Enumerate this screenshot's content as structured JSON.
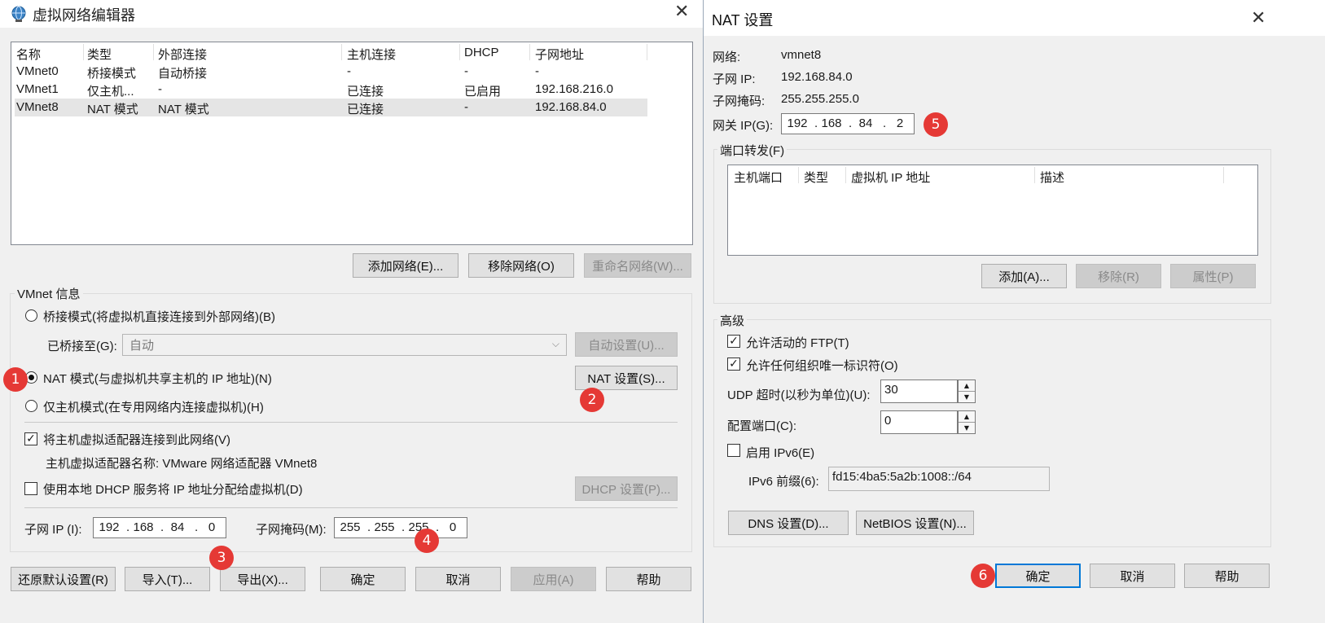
{
  "left_window": {
    "title": "虚拟网络编辑器",
    "icon": "globe-network-icon",
    "list": {
      "columns": [
        "名称",
        "类型",
        "外部连接",
        "主机连接",
        "DHCP",
        "子网地址"
      ],
      "rows": [
        [
          "VMnet0",
          "桥接模式",
          "自动桥接",
          "-",
          "-",
          "-"
        ],
        [
          "VMnet1",
          "仅主机...",
          "-",
          "已连接",
          "已启用",
          "192.168.216.0"
        ],
        [
          "VMnet8",
          "NAT 模式",
          "NAT 模式",
          "已连接",
          "-",
          "192.168.84.0"
        ]
      ]
    },
    "buttons": {
      "add_network": "添加网络(E)...",
      "remove_network": "移除网络(O)",
      "rename_network": "重命名网络(W)..."
    },
    "vmnet_info": {
      "legend": "VMnet 信息",
      "bridge_mode": "桥接模式(将虚拟机直接连接到外部网络)(B)",
      "bridged_to_label": "已桥接至(G):",
      "bridged_to_value": "自动",
      "auto_settings": "自动设置(U)...",
      "nat_mode": "NAT 模式(与虚拟机共享主机的 IP 地址)(N)",
      "nat_settings": "NAT 设置(S)...",
      "host_only_mode": "仅主机模式(在专用网络内连接虚拟机)(H)",
      "connect_adapter": "将主机虚拟适配器连接到此网络(V)",
      "adapter_name": "主机虚拟适配器名称: VMware 网络适配器 VMnet8",
      "use_dhcp": "使用本地 DHCP 服务将 IP 地址分配给虚拟机(D)",
      "dhcp_settings": "DHCP 设置(P)...",
      "subnet_ip_label": "子网 IP (I):",
      "subnet_ip": [
        "192",
        "168",
        "84",
        "0"
      ],
      "subnet_mask_label": "子网掩码(M):",
      "subnet_mask": [
        "255",
        "255",
        "255",
        "0"
      ]
    },
    "bottom_buttons": {
      "restore_defaults": "还原默认设置(R)",
      "import": "导入(T)...",
      "export": "导出(X)...",
      "ok": "确定",
      "cancel": "取消",
      "apply": "应用(A)",
      "help": "帮助"
    }
  },
  "right_window": {
    "title": "NAT 设置",
    "network_label": "网络:",
    "network_value": "vmnet8",
    "subnet_ip_label": "子网 IP:",
    "subnet_ip_value": "192.168.84.0",
    "subnet_mask_label": "子网掩码:",
    "subnet_mask_value": "255.255.255.0",
    "gateway_label": "网关 IP(G):",
    "gateway_ip": [
      "192",
      "168",
      "84",
      "2"
    ],
    "port_forwarding": {
      "legend": "端口转发(F)",
      "columns": [
        "主机端口",
        "类型",
        "虚拟机 IP 地址",
        "描述"
      ],
      "add": "添加(A)...",
      "remove": "移除(R)",
      "properties": "属性(P)"
    },
    "advanced": {
      "legend": "高级",
      "allow_ftp": "允许活动的 FTP(T)",
      "allow_oui": "允许任何组织唯一标识符(O)",
      "udp_timeout_label": "UDP 超时(以秒为单位)(U):",
      "udp_timeout_value": "30",
      "config_port_label": "配置端口(C):",
      "config_port_value": "0",
      "enable_ipv6": "启用 IPv6(E)",
      "ipv6_prefix_label": "IPv6 前缀(6):",
      "ipv6_prefix_value": "fd15:4ba5:5a2b:1008::/64",
      "dns_settings": "DNS 设置(D)...",
      "netbios_settings": "NetBIOS 设置(N)..."
    },
    "buttons": {
      "ok": "确定",
      "cancel": "取消",
      "help": "帮助"
    }
  },
  "annotations": [
    "1",
    "2",
    "3",
    "4",
    "5",
    "6"
  ],
  "colors": {
    "badge": "#e53935",
    "selection_row": "#e5e5e5",
    "primary_border": "#0078d7"
  }
}
